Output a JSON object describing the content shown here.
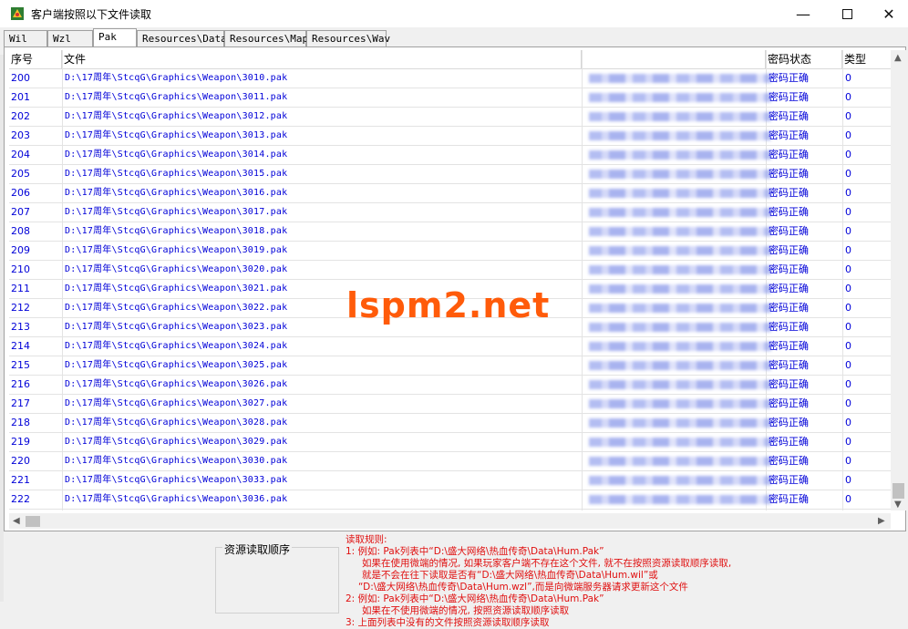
{
  "window": {
    "title": "客户端按照以下文件读取"
  },
  "tabs": [
    {
      "label": "Wil"
    },
    {
      "label": "Wzl"
    },
    {
      "label": "Pak"
    },
    {
      "label": "Resources\\Data"
    },
    {
      "label": "Resources\\Map"
    },
    {
      "label": "Resources\\Wav"
    }
  ],
  "active_tab": "Pak",
  "table": {
    "columns": [
      "序号",
      "文件",
      "",
      "密码状态",
      "类型"
    ],
    "rows": [
      {
        "id": "200",
        "file": "D:\\17周年\\StcqG\\Graphics\\Weapon\\3010.pak",
        "status": "密码正确",
        "type": "0"
      },
      {
        "id": "201",
        "file": "D:\\17周年\\StcqG\\Graphics\\Weapon\\3011.pak",
        "status": "密码正确",
        "type": "0"
      },
      {
        "id": "202",
        "file": "D:\\17周年\\StcqG\\Graphics\\Weapon\\3012.pak",
        "status": "密码正确",
        "type": "0"
      },
      {
        "id": "203",
        "file": "D:\\17周年\\StcqG\\Graphics\\Weapon\\3013.pak",
        "status": "密码正确",
        "type": "0"
      },
      {
        "id": "204",
        "file": "D:\\17周年\\StcqG\\Graphics\\Weapon\\3014.pak",
        "status": "密码正确",
        "type": "0"
      },
      {
        "id": "205",
        "file": "D:\\17周年\\StcqG\\Graphics\\Weapon\\3015.pak",
        "status": "密码正确",
        "type": "0"
      },
      {
        "id": "206",
        "file": "D:\\17周年\\StcqG\\Graphics\\Weapon\\3016.pak",
        "status": "密码正确",
        "type": "0"
      },
      {
        "id": "207",
        "file": "D:\\17周年\\StcqG\\Graphics\\Weapon\\3017.pak",
        "status": "密码正确",
        "type": "0"
      },
      {
        "id": "208",
        "file": "D:\\17周年\\StcqG\\Graphics\\Weapon\\3018.pak",
        "status": "密码正确",
        "type": "0"
      },
      {
        "id": "209",
        "file": "D:\\17周年\\StcqG\\Graphics\\Weapon\\3019.pak",
        "status": "密码正确",
        "type": "0"
      },
      {
        "id": "210",
        "file": "D:\\17周年\\StcqG\\Graphics\\Weapon\\3020.pak",
        "status": "密码正确",
        "type": "0"
      },
      {
        "id": "211",
        "file": "D:\\17周年\\StcqG\\Graphics\\Weapon\\3021.pak",
        "status": "密码正确",
        "type": "0"
      },
      {
        "id": "212",
        "file": "D:\\17周年\\StcqG\\Graphics\\Weapon\\3022.pak",
        "status": "密码正确",
        "type": "0"
      },
      {
        "id": "213",
        "file": "D:\\17周年\\StcqG\\Graphics\\Weapon\\3023.pak",
        "status": "密码正确",
        "type": "0"
      },
      {
        "id": "214",
        "file": "D:\\17周年\\StcqG\\Graphics\\Weapon\\3024.pak",
        "status": "密码正确",
        "type": "0"
      },
      {
        "id": "215",
        "file": "D:\\17周年\\StcqG\\Graphics\\Weapon\\3025.pak",
        "status": "密码正确",
        "type": "0"
      },
      {
        "id": "216",
        "file": "D:\\17周年\\StcqG\\Graphics\\Weapon\\3026.pak",
        "status": "密码正确",
        "type": "0"
      },
      {
        "id": "217",
        "file": "D:\\17周年\\StcqG\\Graphics\\Weapon\\3027.pak",
        "status": "密码正确",
        "type": "0"
      },
      {
        "id": "218",
        "file": "D:\\17周年\\StcqG\\Graphics\\Weapon\\3028.pak",
        "status": "密码正确",
        "type": "0"
      },
      {
        "id": "219",
        "file": "D:\\17周年\\StcqG\\Graphics\\Weapon\\3029.pak",
        "status": "密码正确",
        "type": "0"
      },
      {
        "id": "220",
        "file": "D:\\17周年\\StcqG\\Graphics\\Weapon\\3030.pak",
        "status": "密码正确",
        "type": "0"
      },
      {
        "id": "221",
        "file": "D:\\17周年\\StcqG\\Graphics\\Weapon\\3033.pak",
        "status": "密码正确",
        "type": "0"
      },
      {
        "id": "222",
        "file": "D:\\17周年\\StcqG\\Graphics\\Weapon\\3036.pak",
        "status": "密码正确",
        "type": "0"
      }
    ]
  },
  "order_box": {
    "label": "资源读取顺序"
  },
  "rules": {
    "title": "读取规则:",
    "lines": [
      "1: 例如: Pak列表中“D:\\盛大网络\\热血传奇\\Data\\Hum.Pak”",
      "如果在使用微端的情况, 如果玩家客户端不存在这个文件, 就不在按照资源读取顺序读取,",
      "就是不会在往下读取是否有“D:\\盛大网络\\热血传奇\\Data\\Hum.wil”或",
      "“D:\\盛大网络\\热血传奇\\Data\\Hum.wzl”,而是向微端服务器请求更新这个文件",
      "2: 例如: Pak列表中“D:\\盛大网络\\热血传奇\\Data\\Hum.Pak”",
      "如果在不使用微端的情况, 按照资源读取顺序读取",
      "3: 上面列表中没有的文件按照资源读取顺序读取"
    ]
  },
  "watermark": "lspm2.net",
  "colors": {
    "link_blue": "#0000d8",
    "rules_red": "#e01010",
    "watermark_orange": "#ff5b0a"
  }
}
